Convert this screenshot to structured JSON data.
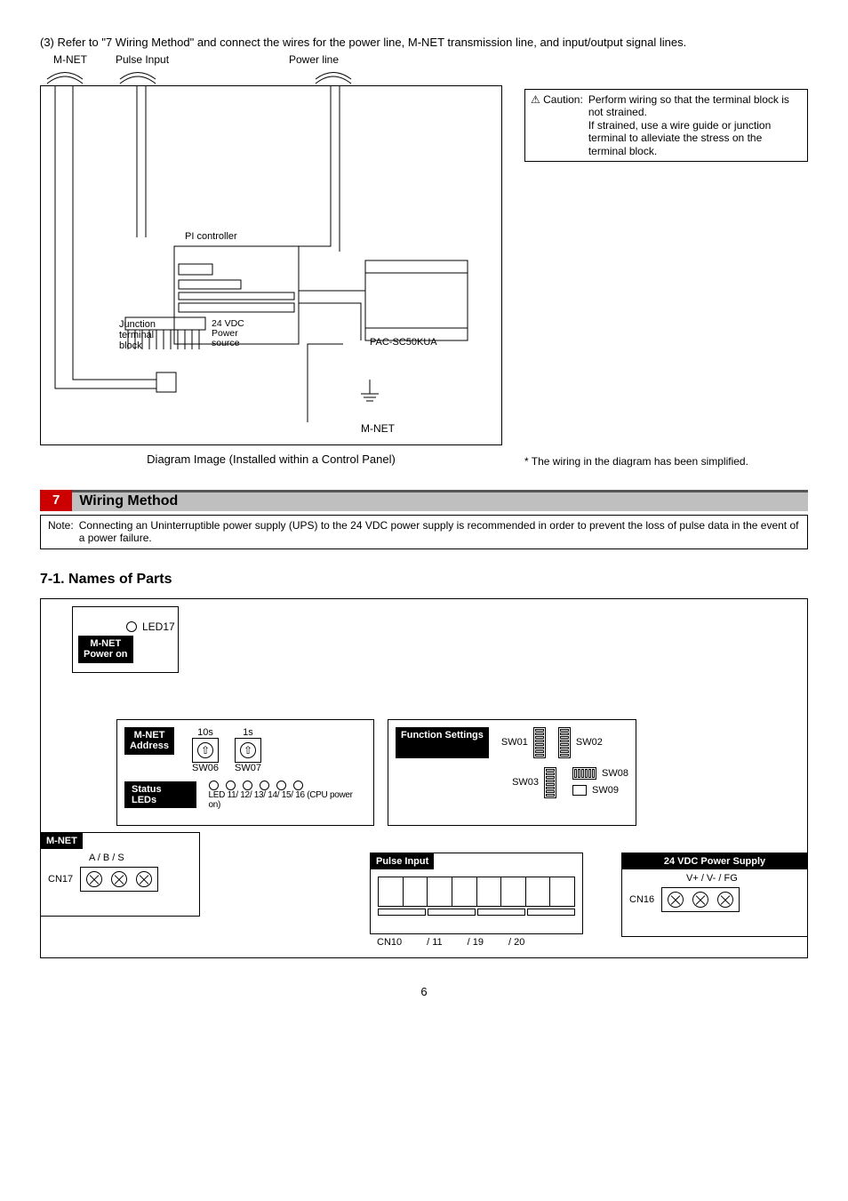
{
  "intro": "(3) Refer to \"7 Wiring Method\" and connect the wires for the power line, M-NET transmission line, and input/output signal lines.",
  "header_labels": {
    "mnet": "M-NET",
    "pulse": "Pulse Input",
    "power": "Power line"
  },
  "diagram": {
    "pi_controller": "PI controller",
    "junction": "Junction\nterminal\nblock",
    "ps": "24 VDC\nPower\nsource",
    "pac": "PAC-SC50KUA",
    "mnet": "M-NET",
    "caption": "Diagram Image (Installed within a Control Panel)"
  },
  "caution": {
    "label": "Caution:",
    "text": "Perform wiring so that the terminal block is not strained.\nIf strained, use a wire guide or junction terminal to alleviate the stress on the terminal block."
  },
  "footnote": "* The wiring in the diagram has been simplified.",
  "section": {
    "num": "7",
    "title": "Wiring Method"
  },
  "note": {
    "label": "Note:",
    "text": "Connecting an Uninterruptible power supply (UPS) to the 24 VDC power supply is recommended in order to prevent the loss of pulse data in the event of a power failure."
  },
  "subheading": "7-1. Names of Parts",
  "parts": {
    "led17": "LED17",
    "mnet_power": "M-NET\nPower on",
    "mnet_addr_title": "M-NET\nAddress",
    "tens": "10s",
    "ones": "1s",
    "sw06": "SW06",
    "sw07": "SW07",
    "status_leds": "Status LEDs",
    "led_labels": "LED 11/   12/   13/   14/   15/   16 (CPU power on)",
    "mnet_title": "M-NET",
    "abs": "A /   B   / S",
    "cn17": "CN17",
    "func_title": "Function Settings",
    "sw01": "SW01",
    "sw02": "SW02",
    "sw03": "SW03",
    "sw08": "SW08",
    "sw09": "SW09",
    "pulse_title": "Pulse Input",
    "cn10": "CN10",
    "cn11": "/ 11",
    "cn19": "/ 19",
    "cn20": "/ 20",
    "ps_title": "24 VDC Power Supply",
    "ps_labels": "V+ /   V- /   FG",
    "cn16": "CN16"
  },
  "page_num": "6"
}
